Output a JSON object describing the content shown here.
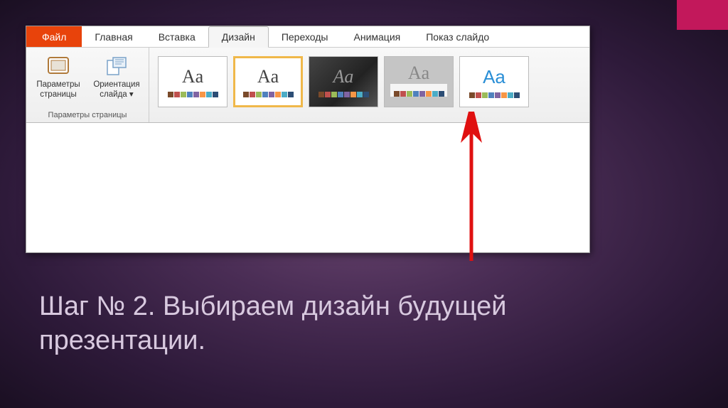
{
  "tabs": {
    "file": "Файл",
    "home": "Главная",
    "insert": "Вставка",
    "design": "Дизайн",
    "transitions": "Переходы",
    "animation": "Анимация",
    "slideshow": "Показ слайдо"
  },
  "group_page_setup": {
    "label": "Параметры страницы",
    "page_params": "Параметры\nстраницы",
    "slide_orient": "Ориентация\nслайда"
  },
  "themes": {
    "sample_text": "Aa"
  },
  "caption": "Шаг № 2. Выбираем дизайн будущей презентации.",
  "swatch_colors": [
    "#7a4a2a",
    "#c0504d",
    "#9bbb59",
    "#4f81bd",
    "#8064a2",
    "#f79646",
    "#4bacc6",
    "#2c4d75"
  ]
}
